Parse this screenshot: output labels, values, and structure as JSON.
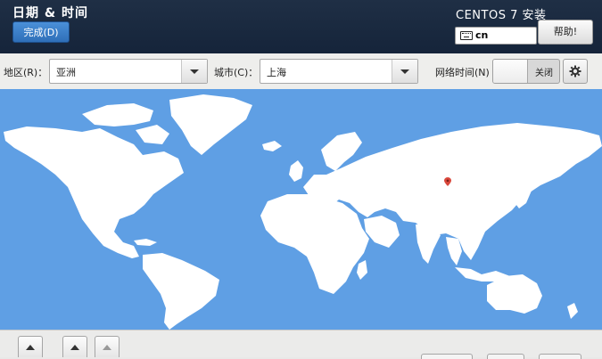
{
  "header": {
    "title": "日期 & 时间",
    "done_label": "完成(D)",
    "install_title": "CENTOS 7 安装",
    "keyboard_layout": "cn",
    "help_label": "帮助!"
  },
  "toolbar": {
    "region_label": "地区(R)：",
    "region_value": "亚洲",
    "city_label": "城市(C)：",
    "city_value": "上海",
    "network_time_label": "网络时间(N)",
    "network_time_state": "关闭"
  },
  "map": {
    "ocean_color": "#5f9fe4",
    "land_color": "#ffffff",
    "selected_city": "上海",
    "pin_icon": "location-pin-icon"
  },
  "icons": {
    "keyboard": "keyboard-icon",
    "gear": "gear-icon",
    "spin_up": "chevron-up-icon"
  },
  "colors": {
    "header_bg": "#1b2a40",
    "accent": "#3a7fcb"
  }
}
